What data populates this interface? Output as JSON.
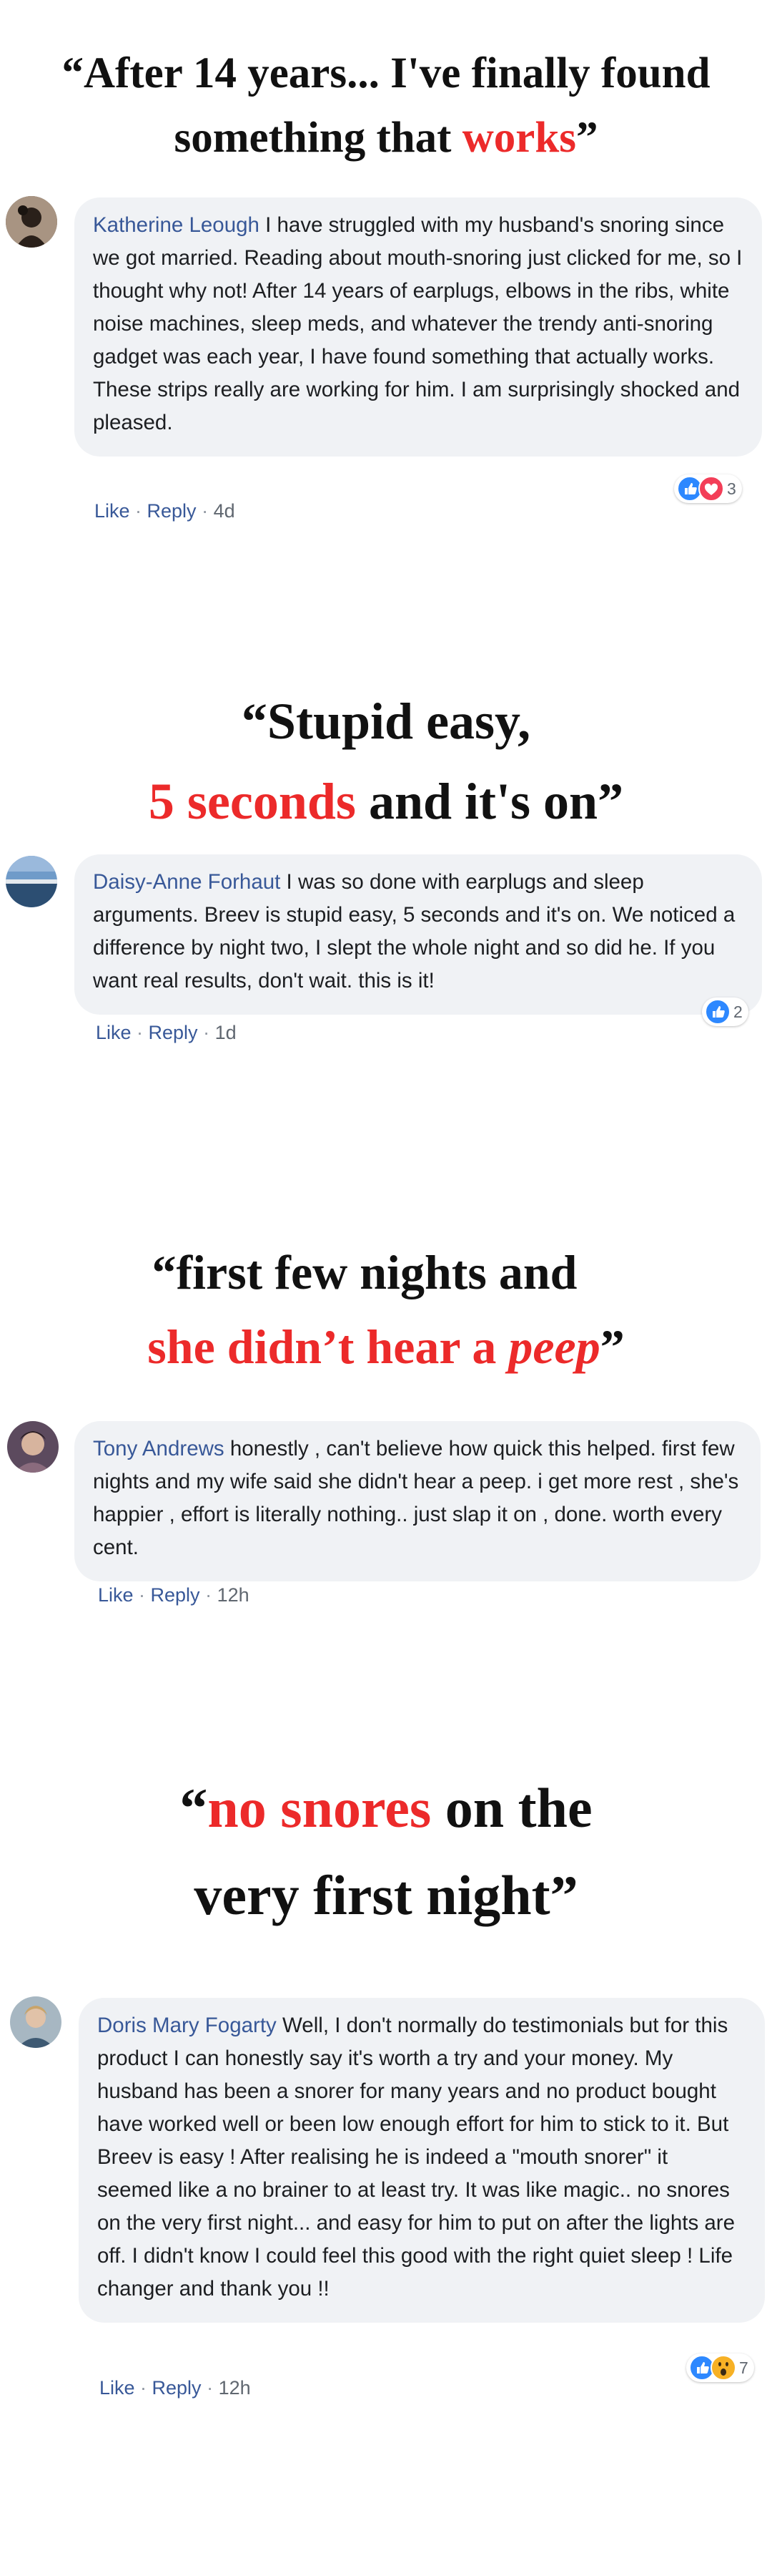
{
  "testimonials": [
    {
      "headline": {
        "line1_a": "“After 14 years... I've finally found",
        "line2_a": "something that ",
        "line2_red": "works",
        "line2_b": "”"
      },
      "comment": {
        "author": "Katherine Leough",
        "text": " I have struggled with my husband's snoring since we got married. Reading about mouth-snoring just clicked for me, so I thought why not! After 14 years of earplugs, elbows in the ribs, white noise machines, sleep meds, and whatever the trendy anti-snoring gadget was each year, I have found something that actually works. These strips really are working for him. I am surprisingly shocked and pleased.",
        "like_label": "Like",
        "reply_label": "Reply",
        "separator": " · ",
        "time": "4d",
        "reaction_icons": [
          "like-icon",
          "love-icon"
        ],
        "reaction_count": "3"
      }
    },
    {
      "headline": {
        "line1_a": "“Stupid easy,",
        "line2_red": "5 seconds",
        "line2_b": " and it's on”"
      },
      "comment": {
        "author": "Daisy-Anne Forhaut",
        "text": " I was so done with earplugs and sleep arguments. Breev is stupid easy, 5 seconds and it's on. We noticed a difference by night two, I slept the whole night and so did he. If you want real results, don't wait. this is it!",
        "like_label": "Like",
        "reply_label": "Reply",
        "separator": " · ",
        "time": "1d",
        "reaction_icons": [
          "like-icon"
        ],
        "reaction_count": "2"
      }
    },
    {
      "headline": {
        "line1_a": "“first few nights and",
        "line2_red": "she didn’t hear a ",
        "line2_red_italic": "peep",
        "line2_b": "”"
      },
      "comment": {
        "author": "Tony Andrews",
        "text": " honestly , can't believe how quick this helped. first few nights and my wife said she didn't hear a peep. i get more rest , she's happier , effort is literally nothing.. just slap it on , done. worth every cent.",
        "like_label": "Like",
        "reply_label": "Reply",
        "separator": " · ",
        "time": "12h"
      }
    },
    {
      "headline": {
        "line1_a": "“",
        "line1_red": "no snores",
        "line1_b": " on the",
        "line2_a": "very first night”"
      },
      "comment": {
        "author": "Doris Mary Fogarty",
        "text": " Well, I don't normally do testimonials but for this product I can honestly say it's worth a try and your money. My husband has been a snorer for many years and no product bought have worked well or been low enough effort for him to stick to it. But Breev is easy ! After realising he is indeed a \"mouth snorer\" it seemed like a no brainer to at least try. It was like magic.. no snores on the very first night... and easy for him to put on after the lights are off. I didn't know I could feel this good with the right quiet sleep ! Life changer and thank you !!",
        "like_label": "Like",
        "reply_label": "Reply",
        "separator": " · ",
        "time": "12h",
        "reaction_icons": [
          "like-icon",
          "wow-icon"
        ],
        "reaction_count": "7"
      }
    }
  ],
  "colors": {
    "highlight_red": "#ec2a2a",
    "name_blue": "#385898",
    "bubble_gray": "#f0f2f5"
  }
}
